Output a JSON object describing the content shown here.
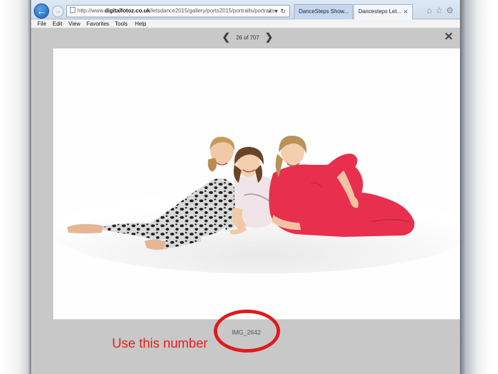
{
  "browser": {
    "url_prefix": "http://www.",
    "url_host": "digitalfotoz.co.uk",
    "url_path": "/letsdance2015/gallery/ports2015/portraits/portraits",
    "tabs": [
      {
        "label": "DanceSteps Show...",
        "active": false
      },
      {
        "label": "Dancesteps Let...",
        "active": true
      }
    ],
    "tab_close": "✕",
    "address_tools": [
      "⌕",
      "▾",
      "↻"
    ],
    "right_icons": [
      "⌂",
      "☆",
      "⚙"
    ]
  },
  "menu": [
    "File",
    "Edit",
    "View",
    "Favorites",
    "Tools",
    "Help"
  ],
  "viewer": {
    "counter": "26 of 707",
    "prev": "❮",
    "next": "❯",
    "close": "✕",
    "filename": "IMG_2642"
  },
  "annotation": {
    "text": "Use this number",
    "color": "#e0201b"
  },
  "colors": {
    "viewer_bg": "#c8c8c8",
    "pink_onesie": "#e8304e",
    "leopard": "#2e2e2e"
  }
}
